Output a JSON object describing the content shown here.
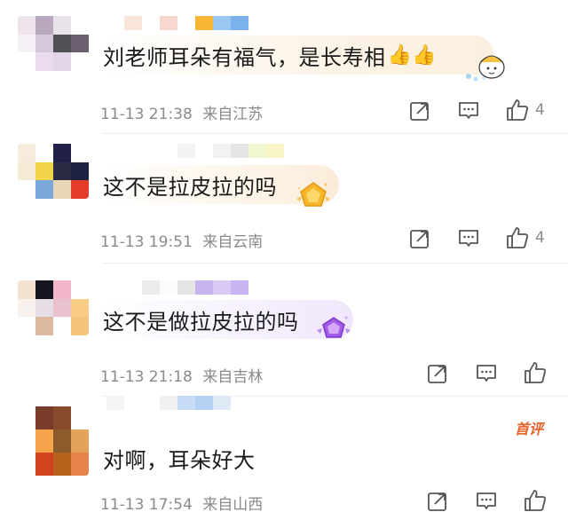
{
  "comments": [
    {
      "text": "刘老师耳朵有福气，是长寿相",
      "emoji": "👍👍",
      "time": "11-13 21:38",
      "location": "来自江苏",
      "like_count": "4",
      "avatar_colors": [
        "#ede4ec",
        "#b9a9bf",
        "#e8e2ea",
        "#ffffff",
        "#f6f0f7",
        "#d6c9db",
        "#4f4f55",
        "#6b5f70",
        "#ffffff",
        "#eadbee",
        "#e3d6e6",
        "#ffffff"
      ],
      "name_colors": [
        "#f9e4d9",
        "#ffffff",
        "#f7d8cf",
        "#ffffff",
        "#f7b733",
        "#9cc7f3",
        "#7ab2ee"
      ]
    },
    {
      "text": "这不是拉皮拉的吗",
      "time": "11-13 19:51",
      "location": "来自云南",
      "like_count": "4",
      "avatar_colors": [
        "#f6ecdc",
        "#ffffff",
        "#202048",
        "#ffffff",
        "#f5ecd6",
        "#f3d34a",
        "#2a2a45",
        "#1c2142",
        "#ffffff",
        "#7aa8d8",
        "#e8d7b7",
        "#e43b28"
      ],
      "name_colors": [
        "#ffffff",
        "#f3f3f3",
        "#ffffff",
        "#f2f2f2",
        "#e4e4e4",
        "#f0f6ce",
        "#f7f5c8"
      ]
    },
    {
      "text": "这不是做拉皮拉的吗",
      "time": "11-13 21:18",
      "location": "来自吉林",
      "like_count": "",
      "avatar_colors": [
        "#f4e3d3",
        "#151520",
        "#f1b6c8",
        "#ffffff",
        "#f7f2ee",
        "#e6dde6",
        "#e8c3cd",
        "#f8cc84",
        "#ffffff",
        "#dcb89e",
        "#ffffff",
        "#f3c47a"
      ],
      "name_colors": [
        "#ffffff",
        "#ececec",
        "#fbfbfb",
        "#e4e4e4",
        "#c7b4ee",
        "#d9c9f5",
        "#c8b6f2"
      ]
    },
    {
      "text": "对啊，耳朵好大",
      "time": "11-13 17:54",
      "location": "来自山西",
      "like_count": "",
      "first_review": "首评",
      "avatar_colors": [
        "#ffffff",
        "#7a3b28",
        "#8a4a2e",
        "#ffffff",
        "#ffffff",
        "#f4a44a",
        "#8d5a2c",
        "#e3a35a",
        "#ffffff",
        "#d2441f",
        "#b5621c",
        "#e6834a"
      ],
      "name_colors": [
        "#f4f4f4",
        "#ffffff",
        "#ffffff",
        "#f1f1f1",
        "#c6dcf6",
        "#b4d0f3",
        "#dfe9f6"
      ]
    }
  ],
  "icons": {
    "share": "share-icon",
    "comment": "comment-icon",
    "like": "thumbs-up-icon"
  },
  "colors": {
    "bubble_gold": "#fbf1e2",
    "bubble_purple": "#f1eafd",
    "meta_text": "#8a8a8a",
    "first_review": "#e8622a"
  }
}
